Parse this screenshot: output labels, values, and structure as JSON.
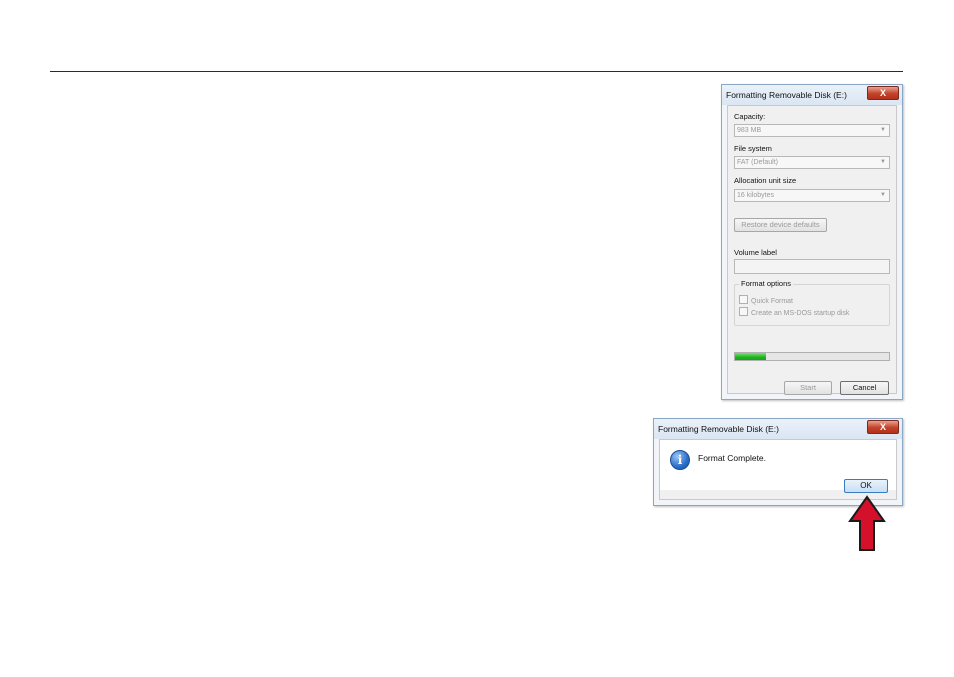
{
  "format_dialog": {
    "title": "Formatting Removable Disk (E:)",
    "close_label": "X",
    "capacity_label": "Capacity:",
    "capacity_value": "983 MB",
    "file_system_label": "File system",
    "file_system_value": "FAT (Default)",
    "allocation_label": "Allocation unit size",
    "allocation_value": "16 kilobytes",
    "restore_button": "Restore device defaults",
    "volume_label": "Volume label",
    "volume_value": "",
    "format_options_title": "Format options",
    "quick_format_label": "Quick Format",
    "msdos_label": "Create an MS-DOS startup disk",
    "progress_fraction": 0.2,
    "start_button": "Start",
    "cancel_button": "Cancel"
  },
  "message_box": {
    "title": "Formatting Removable Disk (E:)",
    "close_label": "X",
    "icon_glyph": "i",
    "message": "Format Complete.",
    "ok_button": "OK"
  },
  "colors": {
    "progress_green": "#1fb51f",
    "arrow_red": "#d4102a"
  },
  "icons": [
    "info-icon",
    "close-icon",
    "dropdown-arrow-icon",
    "red-arrow-pointer"
  ]
}
